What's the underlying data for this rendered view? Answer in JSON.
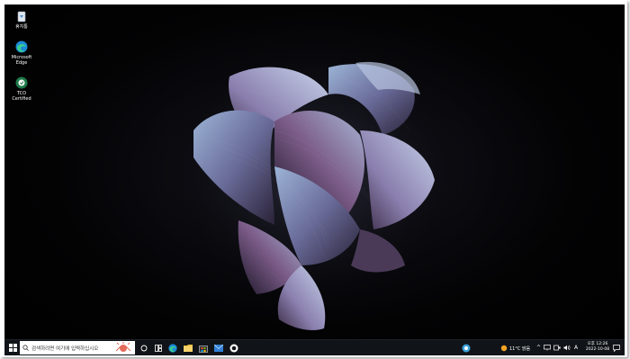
{
  "desktop": {
    "icons": [
      {
        "label": "휴지통",
        "icon": "recycle-bin-icon"
      },
      {
        "label": "Microsoft Edge",
        "icon": "edge-icon"
      },
      {
        "label": "TCO Certified",
        "icon": "tco-icon"
      }
    ],
    "wallpaper": "dark-bloom"
  },
  "taskbar": {
    "search_placeholder": "검색하려면 여기에 입력하십시오",
    "pinned": [
      "task-view-icon",
      "widgets-icon",
      "edge-icon",
      "file-explorer-icon",
      "store-icon",
      "mail-icon",
      "app-icon"
    ],
    "tray": {
      "weather_temp": "11°C 맑음",
      "ime": "A",
      "time": "오후 12:26",
      "date": "2022-10-08"
    }
  },
  "colors": {
    "taskbar_bg": "#101418",
    "accent": "#2f7fd6"
  }
}
